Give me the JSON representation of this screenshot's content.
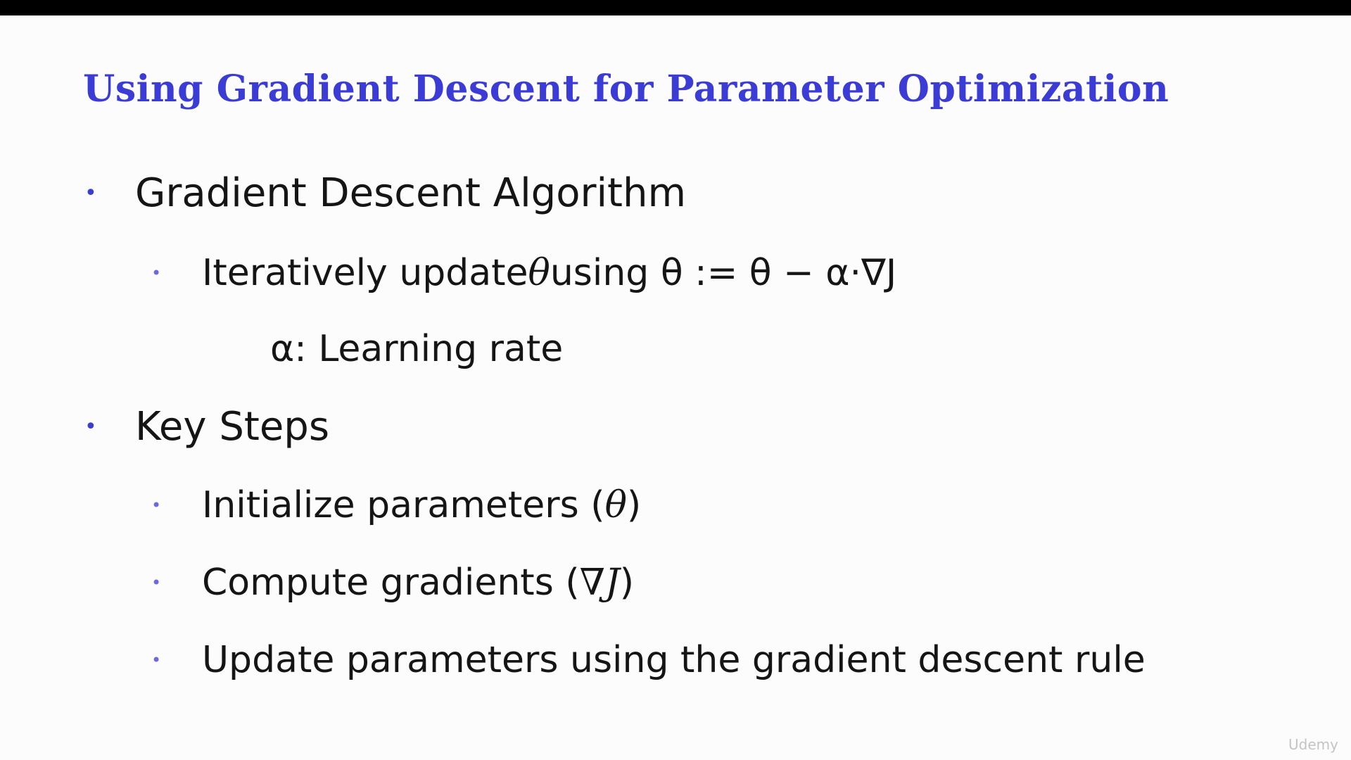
{
  "slide": {
    "title": "Using Gradient Descent for Parameter Optimization",
    "items": [
      {
        "bullet": "•",
        "text": "Gradient Descent Algorithm"
      },
      {
        "bullet": "•",
        "text_prefix": "Iteratively update ",
        "theta": "θ",
        "text_suffix": " using θ := θ − α·∇J"
      },
      {
        "text": "α: Learning rate"
      },
      {
        "bullet": "•",
        "text": "Key Steps"
      },
      {
        "bullet": "•",
        "text_prefix": "Initialize parameters (",
        "math": "θ",
        "text_suffix": ")"
      },
      {
        "bullet": "•",
        "text_prefix": "Compute gradients (",
        "math": "∇J",
        "text_suffix": ")"
      },
      {
        "bullet": "•",
        "text": "Update parameters using the gradient descent rule"
      }
    ]
  },
  "watermark": "Udemy",
  "colors": {
    "title": "#3b3bd6",
    "bullet": "#3b3bd6",
    "text": "#151515",
    "background": "#fcfcfc"
  }
}
